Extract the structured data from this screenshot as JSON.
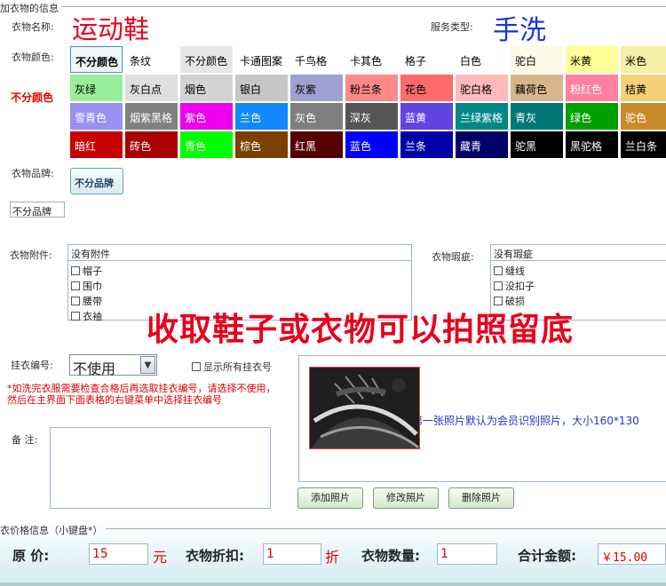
{
  "form": {
    "section_title": "加衣物的信息",
    "name_label": "衣物名称:",
    "name_value": "运动鞋",
    "service_label": "服务类型:",
    "service_value": "手洗",
    "color_label": "衣物颜色:",
    "color_selected": "不分颜色",
    "brand_label": "衣物品牌:",
    "brand_button": "不分品牌",
    "brand_selected": "不分品牌",
    "accessory_label": "衣物附件:",
    "accessory_header": "没有附件",
    "accessory_items": [
      "帽子",
      "围巾",
      "腰带",
      "衣袖"
    ],
    "defect_label": "衣物瑕疵:",
    "defect_header": "没有瑕疵",
    "defect_items": [
      "缝线",
      "没扣子",
      "破损"
    ],
    "overlay_text": "收取鞋子或衣物可以拍照留底",
    "hanger_label": "挂衣编号:",
    "hanger_value": "不使用",
    "show_all_hangers": "显示所有挂衣号",
    "hanger_note": "*如洗完衣服需要检查合格后再选取挂衣编号，请选择不使用，然后在主界面下面表格的右键菜单中选择挂衣编号",
    "remark_label": "备 注:",
    "photo_note": "第一张照片默认为会员识别照片，大小160*130",
    "photo_buttons": [
      "添加照片",
      "修改照片",
      "删除照片"
    ]
  },
  "colors": [
    [
      {
        "name": "不分颜色",
        "bg": "#eef6f8",
        "fg": "#000000"
      },
      {
        "name": "条纹",
        "bg": "#ffffff",
        "fg": "#000000"
      },
      {
        "name": "不分颜色",
        "bg": "#e6e6e6",
        "fg": "#000000"
      },
      {
        "name": "卡通图案",
        "bg": "#ffffff",
        "fg": "#000000"
      },
      {
        "name": "千鸟格",
        "bg": "#ffffff",
        "fg": "#000000"
      },
      {
        "name": "卡其色",
        "bg": "#ffffff",
        "fg": "#000000"
      },
      {
        "name": "格子",
        "bg": "#ffffff",
        "fg": "#000000"
      },
      {
        "name": "白色",
        "bg": "#ffffff",
        "fg": "#000000"
      },
      {
        "name": "驼白",
        "bg": "#fdfbe6",
        "fg": "#000000"
      },
      {
        "name": "米黄",
        "bg": "#ffff99",
        "fg": "#000000"
      },
      {
        "name": "米色",
        "bg": "#f6efa6",
        "fg": "#000000"
      }
    ],
    [
      {
        "name": "灰绿",
        "bg": "#99ee99",
        "fg": "#000000"
      },
      {
        "name": "灰白点",
        "bg": "#dfdfdf",
        "fg": "#000000"
      },
      {
        "name": "烟色",
        "bg": "#d3d3d3",
        "fg": "#000000"
      },
      {
        "name": "银白",
        "bg": "#c6c6c6",
        "fg": "#000000"
      },
      {
        "name": "灰紫",
        "bg": "#a0a0d2",
        "fg": "#000000"
      },
      {
        "name": "粉兰条",
        "bg": "#ff8888",
        "fg": "#000000"
      },
      {
        "name": "花色",
        "bg": "#ff6b6b",
        "fg": "#000000"
      },
      {
        "name": "驼白格",
        "bg": "#ffbbbb",
        "fg": "#000000"
      },
      {
        "name": "藕荷色",
        "bg": "#d8b68c",
        "fg": "#000000"
      },
      {
        "name": "粉红色",
        "bg": "#ff80a0",
        "fg": "#ffffff"
      },
      {
        "name": "桔黄",
        "bg": "#f4d078",
        "fg": "#000000"
      }
    ],
    [
      {
        "name": "雪青色",
        "bg": "#9b8ff0",
        "fg": "#ffffff"
      },
      {
        "name": "烟紫黑格",
        "bg": "#808080",
        "fg": "#ffffff"
      },
      {
        "name": "紫色",
        "bg": "#ee00ee",
        "fg": "#ffffff"
      },
      {
        "name": "兰色",
        "bg": "#1188ff",
        "fg": "#ffffff"
      },
      {
        "name": "灰色",
        "bg": "#7f7f7f",
        "fg": "#ffffff"
      },
      {
        "name": "深灰",
        "bg": "#555555",
        "fg": "#ffffff"
      },
      {
        "name": "蓝黄",
        "bg": "#6244e0",
        "fg": "#ffffff"
      },
      {
        "name": "兰绿紫格",
        "bg": "#008888",
        "fg": "#ffffff"
      },
      {
        "name": "青灰",
        "bg": "#007777",
        "fg": "#ffffff"
      },
      {
        "name": "绿色",
        "bg": "#00a000",
        "fg": "#ffffff"
      },
      {
        "name": "驼色",
        "bg": "#c88b2c",
        "fg": "#ffffff"
      }
    ],
    [
      {
        "name": "暗红",
        "bg": "#c80000",
        "fg": "#ffffff"
      },
      {
        "name": "砖色",
        "bg": "#aa0000",
        "fg": "#ffffff"
      },
      {
        "name": "青色",
        "bg": "#00ff00",
        "fg": "#ffffff"
      },
      {
        "name": "棕色",
        "bg": "#7a4000",
        "fg": "#ffffff"
      },
      {
        "name": "红黑",
        "bg": "#550000",
        "fg": "#ffffff"
      },
      {
        "name": "蓝色",
        "bg": "#0000ff",
        "fg": "#ffffff"
      },
      {
        "name": "兰条",
        "bg": "#0000aa",
        "fg": "#ffffff"
      },
      {
        "name": "藏青",
        "bg": "#00006a",
        "fg": "#ffffff"
      },
      {
        "name": "驼黑",
        "bg": "#000000",
        "fg": "#ffffff"
      },
      {
        "name": "黑驼格",
        "bg": "#000000",
        "fg": "#ffffff"
      },
      {
        "name": "兰白条",
        "bg": "#000000",
        "fg": "#ffffff"
      }
    ]
  ],
  "price": {
    "section_title": "衣价格信息（小键盘*）",
    "original_label": "原      价:",
    "original_value": "15",
    "original_unit": "元",
    "discount_label": "衣物折扣:",
    "discount_value": "1",
    "discount_unit": "折",
    "qty_label": "衣物数量:",
    "qty_value": "1",
    "total_label": "合计金额:",
    "total_value": "￥15.00"
  }
}
